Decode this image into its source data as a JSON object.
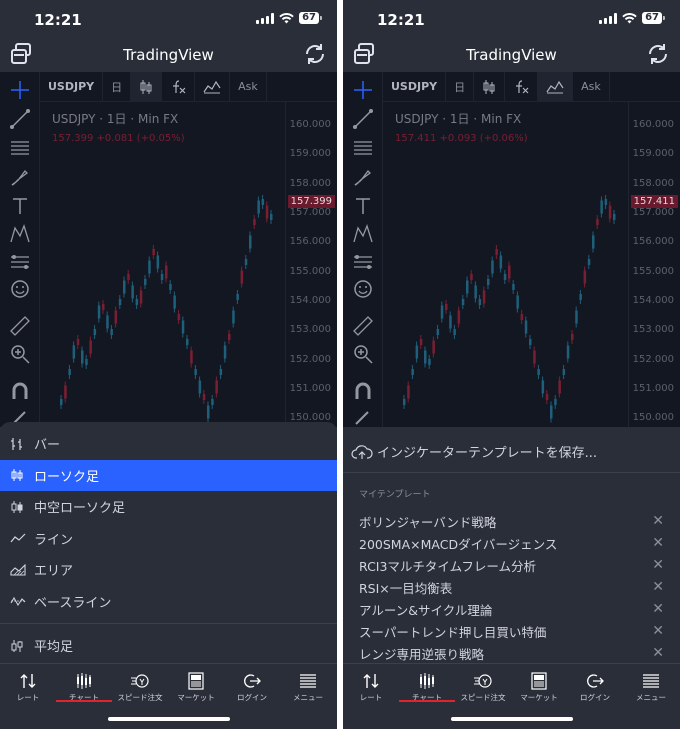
{
  "status": {
    "time": "12:21",
    "battery": "67"
  },
  "header": {
    "title": "TradingView"
  },
  "chart_toolbar": {
    "symbol": "USDJPY",
    "interval": "日",
    "candles_icon": "candles-icon",
    "indicators_icon": "fx-icon",
    "templates_icon": "templates-icon",
    "ask": "Ask"
  },
  "chart_legend": {
    "title": "USDJPY · 1日 · Min FX"
  },
  "left_phone": {
    "price_line": "157.399 +0.081 (+0.05%)",
    "last_price": "157.399",
    "axis_ticks": [
      "160.000",
      "159.000",
      "158.000",
      "157.000",
      "156.000",
      "155.000",
      "154.000",
      "153.000",
      "152.000",
      "151.000",
      "150.000"
    ],
    "chart_types": [
      {
        "label": "バー",
        "icon": "bar-chart-icon",
        "selected": false
      },
      {
        "label": "ローソク足",
        "icon": "candles-icon",
        "selected": true
      },
      {
        "label": "中空ローソク足",
        "icon": "hollow-candles-icon",
        "selected": false
      },
      {
        "label": "ライン",
        "icon": "line-chart-icon",
        "selected": false
      },
      {
        "label": "エリア",
        "icon": "area-chart-icon",
        "selected": false
      },
      {
        "label": "ベースライン",
        "icon": "baseline-chart-icon",
        "selected": false
      }
    ],
    "extra_type": {
      "label": "平均足",
      "icon": "heikin-ashi-icon"
    }
  },
  "right_phone": {
    "price_line": "157.411 +0.093 (+0.06%)",
    "last_price": "157.411",
    "axis_ticks": [
      "160.000",
      "159.000",
      "158.000",
      "157.000",
      "156.000",
      "155.000",
      "154.000",
      "153.000",
      "152.000",
      "151.000",
      "150.000"
    ],
    "save_template": "インジケーターテンプレートを保存...",
    "section_label": "マイテンプレート",
    "templates": [
      "ボリンジャーバンド戦略",
      "200SMA×MACDダイバージェンス",
      "RCI3マルチタイムフレーム分析",
      "RSI×一目均衡表",
      "アルーン&サイクル理論",
      "スーパートレンド押し目買い特価",
      "レンジ専用逆張り戦略"
    ]
  },
  "nav": [
    {
      "label": "レート",
      "icon": "rate-arrows-icon"
    },
    {
      "label": "チャート",
      "icon": "chart-candles-icon"
    },
    {
      "label": "スピード注文",
      "icon": "speed-order-icon"
    },
    {
      "label": "マーケット",
      "icon": "news-icon"
    },
    {
      "label": "ログイン",
      "icon": "login-icon"
    },
    {
      "label": "メニュー",
      "icon": "menu-icon"
    }
  ],
  "colors": {
    "accent": "#2962ff",
    "nav_active": "#e0242f",
    "down_candle": "#7a1f33",
    "up_candle": "#1f5f7a"
  }
}
